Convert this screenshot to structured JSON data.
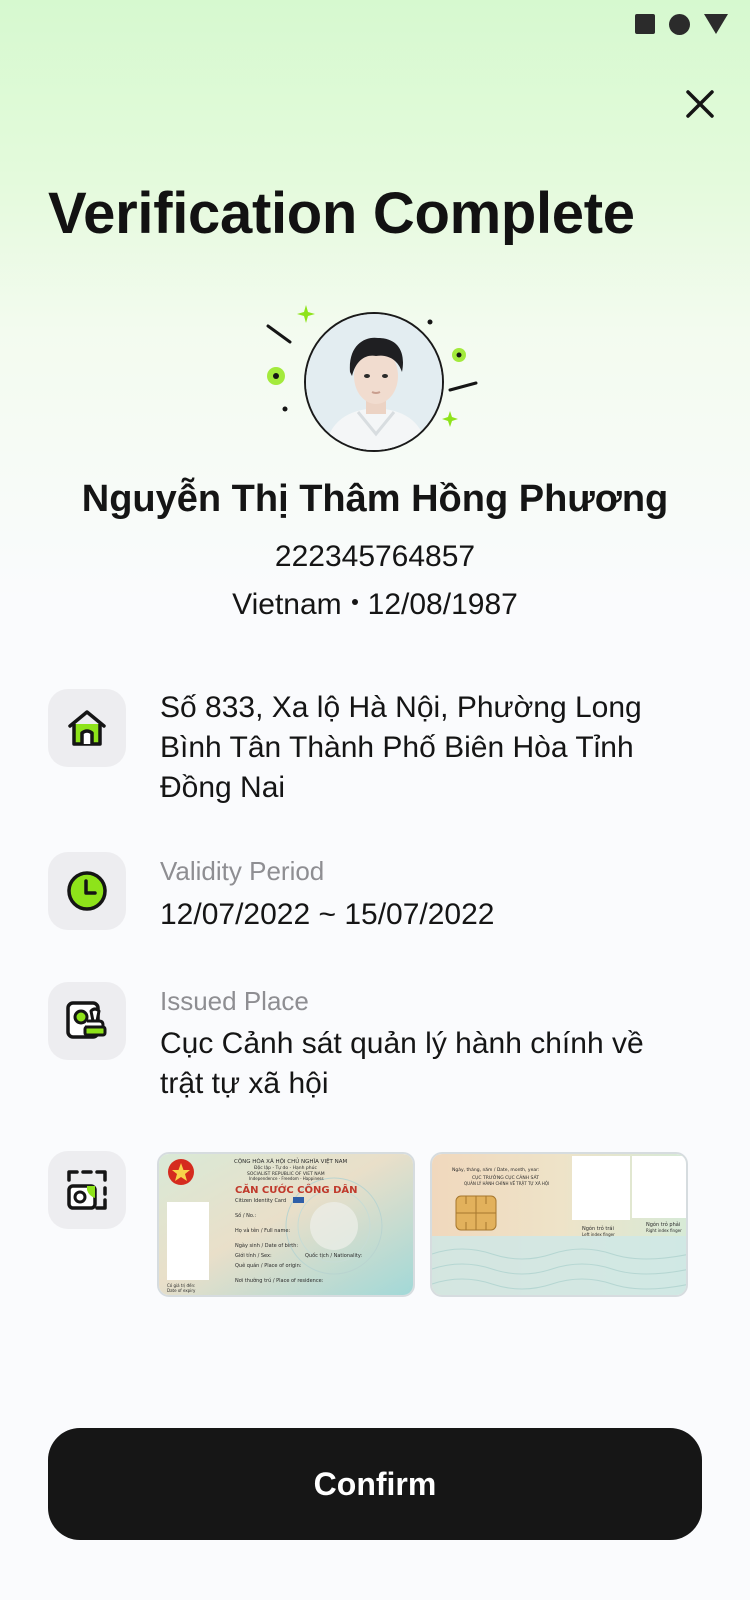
{
  "status_bar": {
    "icons": [
      "square-icon",
      "circle-icon",
      "triangle-icon"
    ]
  },
  "header": {
    "title": "Verification Complete",
    "close_icon": "close-icon"
  },
  "profile": {
    "name": "Nguyễn Thị Thâm Hồng Phương",
    "id_number": "222345764857",
    "nationality": "Vietnam",
    "birth_date": "12/08/1987"
  },
  "details": {
    "address": {
      "icon": "home-icon",
      "lines": [
        "Số 833, Xa lộ Hà Nội, Phường Long",
        "Bình Tân Thành Phố Biên Hòa Tỉnh",
        "Đồng Nai"
      ]
    },
    "validity": {
      "icon": "clock-icon",
      "label": "Validity Period",
      "value": "12/07/2022 ~ 15/07/2022"
    },
    "issued_place": {
      "icon": "stamp-icon",
      "label": "Issued Place",
      "lines": [
        "Cục Cảnh sát quản lý hành chính về",
        "trật tự xã hội"
      ]
    },
    "id_images": {
      "icon": "id-scan-icon",
      "front": {
        "header_line1": "CỘNG HÒA XÃ HỘI CHỦ NGHĨA VIỆT NAM",
        "header_line2": "Độc lập - Tự do - Hạnh phúc",
        "header_line3": "SOCIALIST REPUBLIC OF VIET NAM",
        "header_line4": "Independence - Freedom - Happiness",
        "card_title": "CĂN CƯỚC CÔNG DÂN",
        "card_subtitle": "Citizen Identity Card",
        "field_no": "Số / No.:",
        "field_name": "Họ và tên / Full name:",
        "field_dob": "Ngày sinh / Date of birth:",
        "field_sex": "Giới tính / Sex:",
        "field_nat": "Quốc tịch / Nationality:",
        "field_origin": "Quê quán / Place of origin:",
        "field_residence": "Nơi thường trú / Place of residence:",
        "field_expiry": "Có giá trị đến:",
        "field_expiry_en": "Date of expiry"
      },
      "back": {
        "date_line": "Ngày, tháng, năm / Date, month, year:",
        "authority_line1": "CỤC TRƯỞNG CỤC CẢNH SÁT",
        "authority_line2": "QUẢN LÝ HÀNH CHÍNH VỀ TRẬT TỰ XÃ HỘI",
        "left_finger": "Ngón trỏ trái",
        "left_finger_en": "Left index finger",
        "right_finger": "Ngón trỏ phải",
        "right_finger_en": "Right index finger"
      }
    }
  },
  "footer": {
    "confirm_label": "Confirm"
  },
  "colors": {
    "accent": "#8ee31a",
    "button": "#161616",
    "background": "#fafbfd"
  }
}
